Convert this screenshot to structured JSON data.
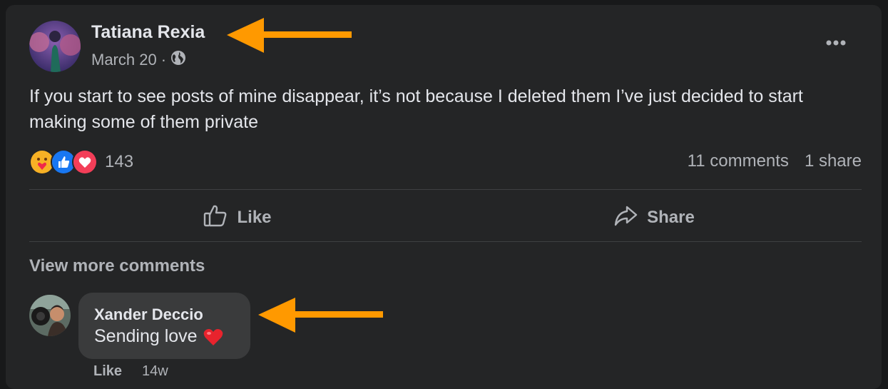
{
  "post": {
    "author": "Tatiana Rexia",
    "date": "March 20",
    "separator": "·",
    "audience_icon": "globe-icon",
    "text": "If you start to see posts of mine disappear, it’s not because I deleted them I’ve just decided to start making some of them private",
    "reaction_icons": [
      "care-reaction-icon",
      "like-reaction-icon",
      "love-reaction-icon"
    ],
    "reaction_count": "143",
    "comments_count": "11 comments",
    "shares_count": "1 share"
  },
  "actions": {
    "like_label": "Like",
    "share_label": "Share"
  },
  "comments": {
    "view_more": "View more comments",
    "items": [
      {
        "author": "Xander Deccio",
        "text": "Sending love",
        "emoji": "❤️",
        "like_label": "Like",
        "age": "14w"
      }
    ]
  },
  "colors": {
    "background": "#242526",
    "text": "#e4e6eb",
    "muted": "#b0b3b8",
    "annotation_arrow": "#ff9900"
  }
}
